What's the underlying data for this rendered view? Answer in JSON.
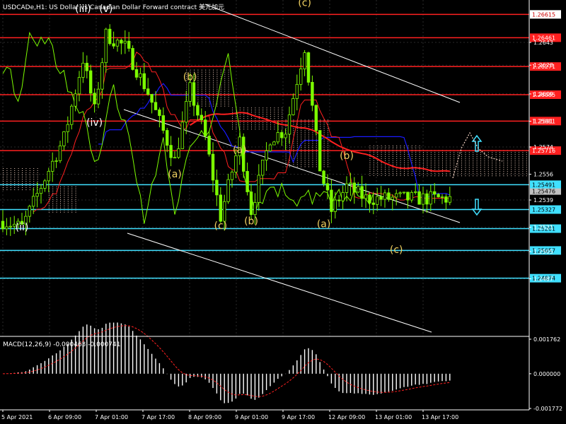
{
  "chart_data": {
    "type": "candlestick",
    "title": "USDCADe,H1: US Dollar vs Canadian Dollar Forward contract 美元加元",
    "price_axis": {
      "min": 1.2449,
      "max": 1.2671,
      "ticks": [
        1.2643,
        1.2628,
        1.2609,
        1.2591,
        1.2574,
        1.2556,
        1.2539,
        1.2521,
        1.2505,
        1.2487
      ]
    },
    "horizontal_levels": [
      {
        "value": "1.26615",
        "color": "#ff2020",
        "badge_bg": "#ffffff",
        "badge_fg": "#cc0000"
      },
      {
        "value": "1.26461",
        "color": "#ff2020",
        "badge_bg": "#ff2020",
        "badge_fg": "#ffffff"
      },
      {
        "value": "1.26271",
        "color": "#ff2020",
        "badge_bg": "#ff2020",
        "badge_fg": "#ffffff"
      },
      {
        "value": "1.26085",
        "color": "#ff2020",
        "badge_bg": "#ff2020",
        "badge_fg": "#ffffff"
      },
      {
        "value": "1.25911",
        "color": "#ff2020",
        "badge_bg": "#ff2020",
        "badge_fg": "#ffffff"
      },
      {
        "value": "1.25716",
        "color": "#ff2020",
        "badge_bg": "#ff2020",
        "badge_fg": "#ffffff"
      },
      {
        "value": "1.25491",
        "color": "#40e0ff",
        "badge_bg": "#40e0ff",
        "badge_fg": "#000000"
      },
      {
        "value": "1.25327",
        "color": "#40e0ff",
        "badge_bg": "#40e0ff",
        "badge_fg": "#000000"
      },
      {
        "value": "1.25201",
        "color": "#40e0ff",
        "badge_bg": "#40e0ff",
        "badge_fg": "#000000"
      },
      {
        "value": "1.25057",
        "color": "#40e0ff",
        "badge_bg": "#40e0ff",
        "badge_fg": "#000000"
      },
      {
        "value": "1.24874",
        "color": "#40e0ff",
        "badge_bg": "#40e0ff",
        "badge_fg": "#000000"
      }
    ],
    "current_price": "1.25476",
    "x_labels": [
      "5 Apr 2021",
      "6 Apr 09:00",
      "7 Apr 01:00",
      "7 Apr 17:00",
      "8 Apr 09:00",
      "9 Apr 01:00",
      "9 Apr 17:00",
      "12 Apr 09:00",
      "13 Apr 01:00",
      "13 Apr 17:00"
    ],
    "wave_labels": [
      {
        "text": "(iii)",
        "color": "#ffffff",
        "i": 21,
        "price": 1.2663
      },
      {
        "text": "(v)",
        "color": "#ffffff",
        "i": 27,
        "price": 1.2663
      },
      {
        "text": "(iv)",
        "color": "#ffffff",
        "i": 24,
        "price": 1.2588
      },
      {
        "text": "(ii)",
        "color": "#ffffff",
        "i": 5,
        "price": 1.2519
      },
      {
        "text": "(b)",
        "color": "#f0d060",
        "i": 49,
        "price": 1.2618
      },
      {
        "text": "(a)",
        "color": "#f0d060",
        "i": 45,
        "price": 1.2554
      },
      {
        "text": "(a)",
        "color": "#f0d060",
        "i": 62,
        "price": 1.257
      },
      {
        "text": "(c)",
        "color": "#f0d060",
        "i": 57,
        "price": 1.252
      },
      {
        "text": "(b)",
        "color": "#f0d060",
        "i": 65,
        "price": 1.2523
      },
      {
        "text": "(c)",
        "color": "#f0d060",
        "i": 79,
        "price": 1.2667
      },
      {
        "text": "(a)",
        "color": "#f0d060",
        "i": 84,
        "price": 1.2521
      },
      {
        "text": "(b)",
        "color": "#f0d060",
        "i": 90,
        "price": 1.2566
      },
      {
        "text": "(c)",
        "color": "#f0d060",
        "i": 103,
        "price": 1.2504
      }
    ],
    "indicator": {
      "name": "MACD",
      "params": "MACD(12,26,9) -0.000463 -0.000741",
      "ylim": [
        -0.001772,
        0.001762
      ],
      "ticks": [
        "0.001762",
        "0.000000",
        "-0.001772"
      ]
    },
    "colors": {
      "bull_candle": "#7cfc00",
      "bear_candle": "#7cfc00",
      "tenkan": "#ff2020",
      "kijun": "#1a1aff",
      "chikou": "#7cfc00",
      "cloud_dots": "#f0d0c0",
      "channel": "#ffffff",
      "macd_hist": "#ffffff",
      "macd_signal": "#ff2020",
      "arrow": "#40e0ff"
    }
  }
}
